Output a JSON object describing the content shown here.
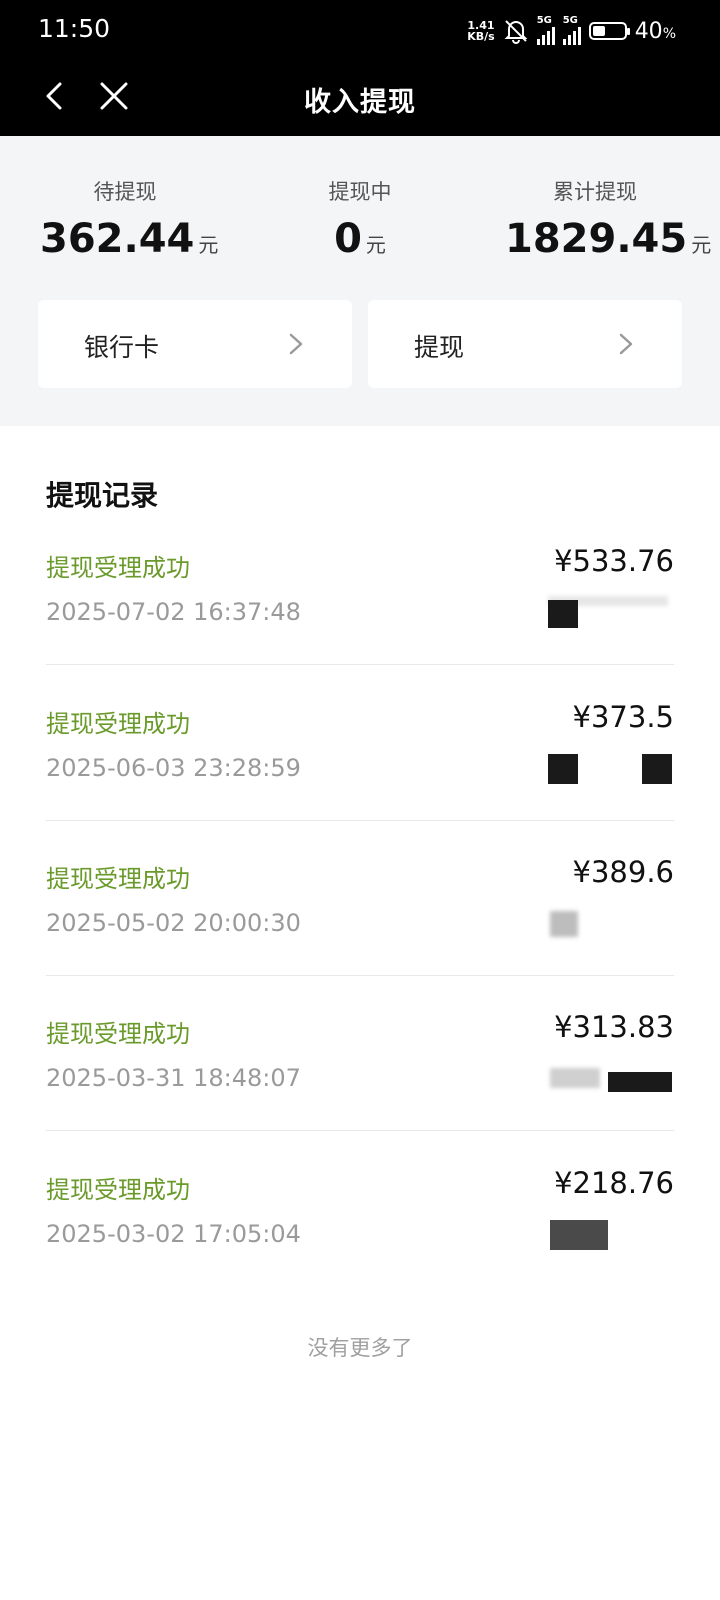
{
  "status_bar": {
    "time": "11:50",
    "net_speed_value": "1.41",
    "net_speed_unit": "KB/s",
    "signal1_label": "5G",
    "signal2_label": "5G",
    "battery_percent": "40",
    "battery_suffix": "%",
    "battery_level": 0.4,
    "icons": [
      "bell-muted-icon",
      "signal-icon",
      "signal-icon",
      "battery-icon"
    ]
  },
  "nav": {
    "title": "收入提现",
    "back_icon": "chevron-left-icon",
    "close_icon": "close-icon"
  },
  "summary": {
    "pending": {
      "label": "待提现",
      "value": "362.44",
      "unit": "元"
    },
    "processing": {
      "label": "提现中",
      "value": "0",
      "unit": "元"
    },
    "total": {
      "label": "累计提现",
      "value": "1829.45",
      "unit": "元"
    }
  },
  "actions": {
    "bank_card": "银行卡",
    "withdraw": "提现",
    "chevron_icon": "chevron-right-icon"
  },
  "records": {
    "title": "提现记录",
    "items": [
      {
        "status": "提现受理成功",
        "datetime": "2025-07-02 16:37:48",
        "amount": "¥533.76"
      },
      {
        "status": "提现受理成功",
        "datetime": "2025-06-03 23:28:59",
        "amount": "¥373.5"
      },
      {
        "status": "提现受理成功",
        "datetime": "2025-05-02 20:00:30",
        "amount": "¥389.6"
      },
      {
        "status": "提现受理成功",
        "datetime": "2025-03-31 18:48:07",
        "amount": "¥313.83"
      },
      {
        "status": "提现受理成功",
        "datetime": "2025-03-02 17:05:04",
        "amount": "¥218.76"
      }
    ],
    "end_text": "没有更多了"
  },
  "colors": {
    "status_success": "#6a9a2a",
    "summary_bg": "#f4f5f7",
    "topbar_bg": "#000000"
  }
}
